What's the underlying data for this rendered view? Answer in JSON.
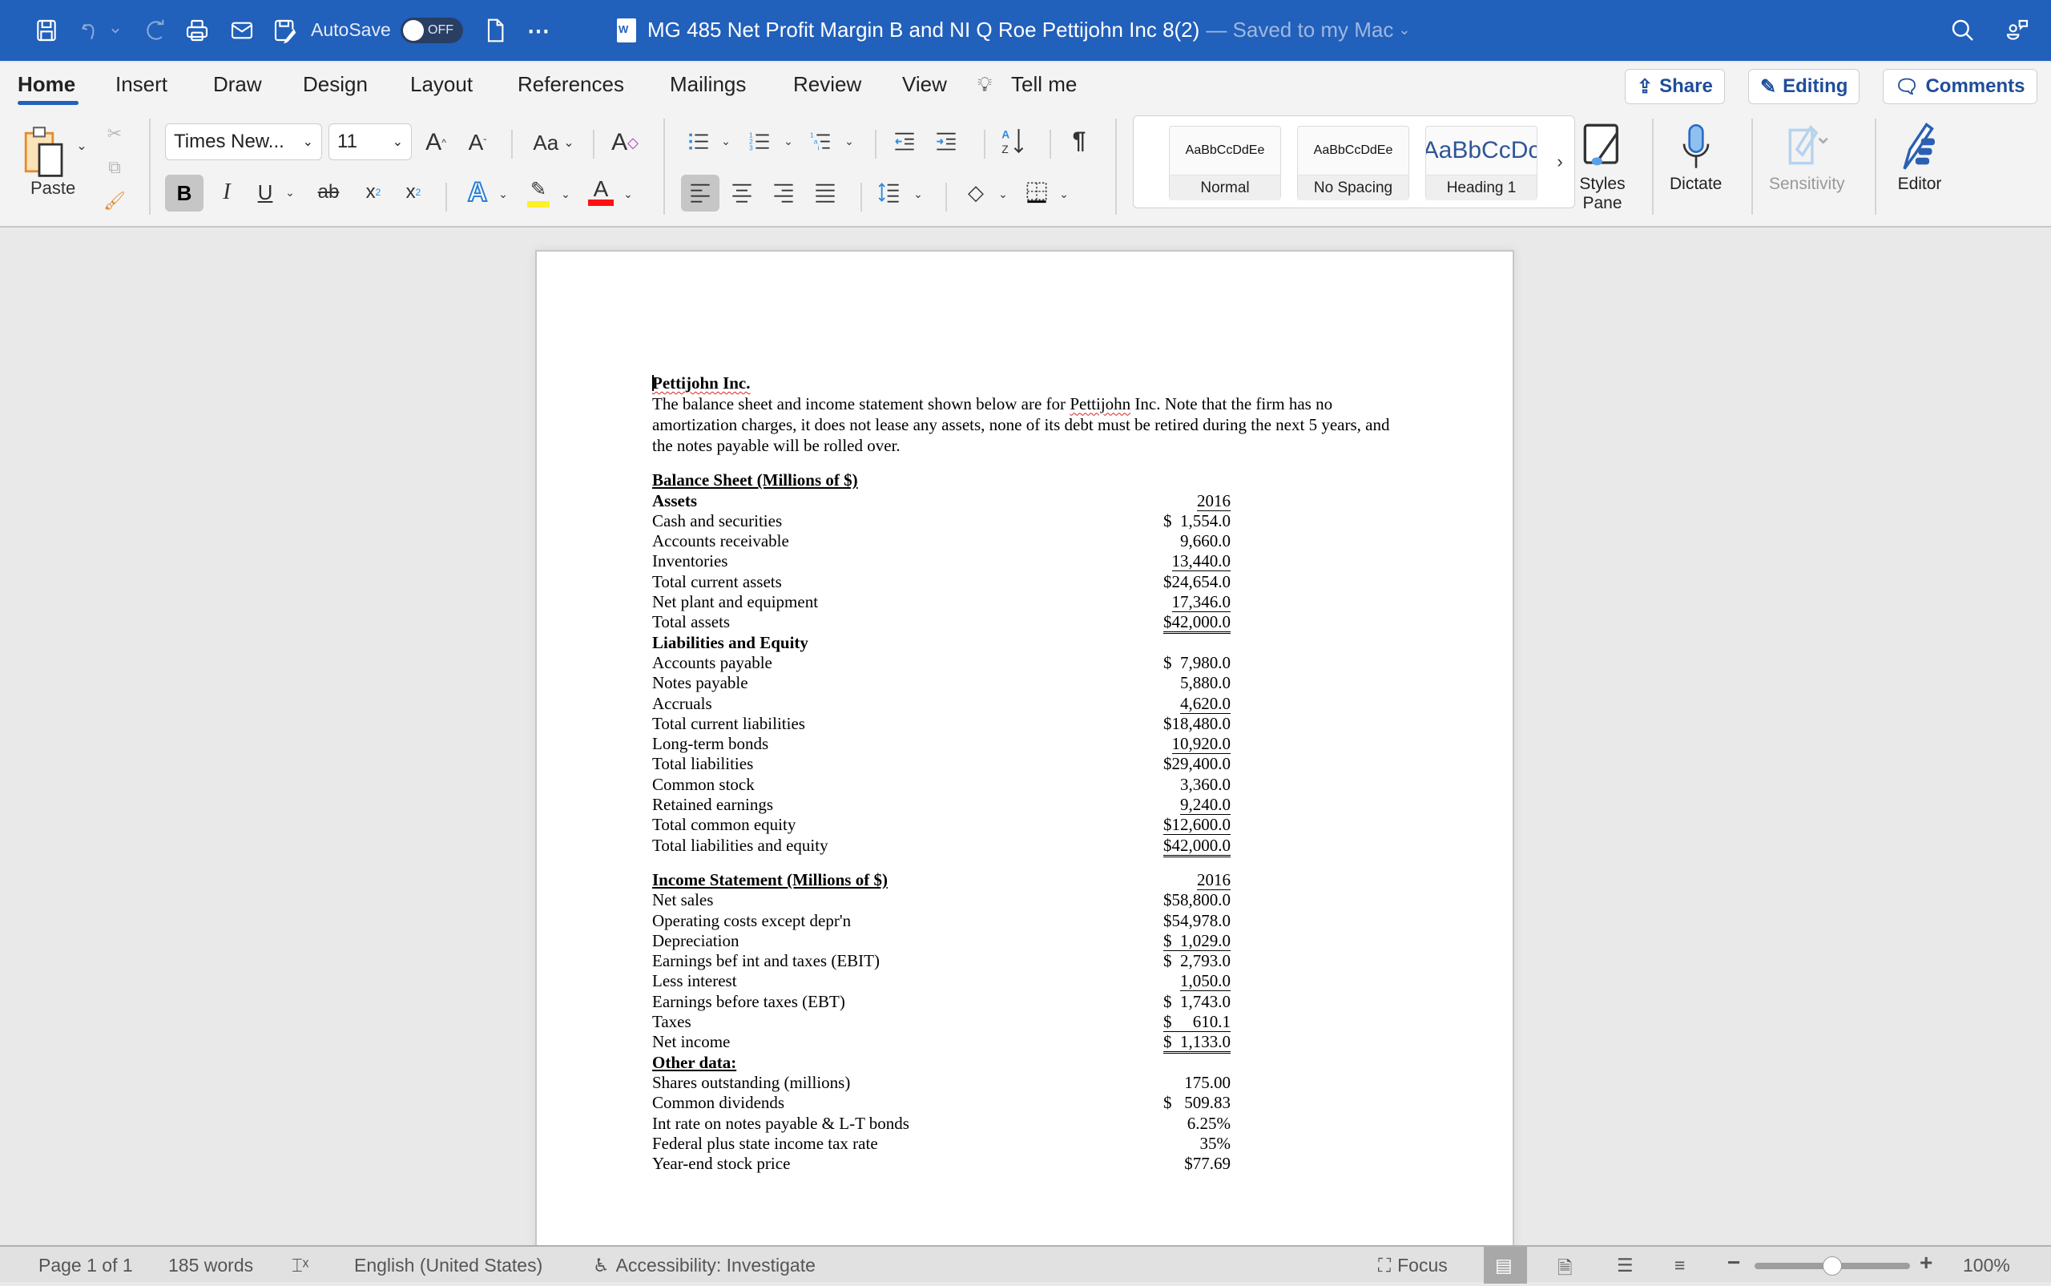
{
  "titlebar": {
    "autosave_label": "AutoSave",
    "autosave_state": "OFF",
    "document_title": "MG 485 Net Profit Margin B and NI Q Roe Pettijohn Inc 8(2)",
    "save_status": "— Saved to my Mac",
    "accent_color": "#2160bb"
  },
  "tabs": [
    {
      "label": "Home",
      "active": true
    },
    {
      "label": "Insert"
    },
    {
      "label": "Draw"
    },
    {
      "label": "Design"
    },
    {
      "label": "Layout"
    },
    {
      "label": "References"
    },
    {
      "label": "Mailings"
    },
    {
      "label": "Review"
    },
    {
      "label": "View"
    },
    {
      "label": "Tell me"
    }
  ],
  "header_buttons": {
    "share": "Share",
    "editing": "Editing",
    "comments": "Comments"
  },
  "ribbon": {
    "paste_label": "Paste",
    "font_name": "Times New...",
    "font_size": "11",
    "change_case": "Aa",
    "bold": "B",
    "italic": "I",
    "underline": "U",
    "strike": "ab",
    "styles": [
      {
        "preview": "AaBbCcDdEe",
        "name": "Normal"
      },
      {
        "preview": "AaBbCcDdEe",
        "name": "No Spacing"
      },
      {
        "preview": "AaBbCcDc",
        "name": "Heading 1"
      }
    ],
    "styles_pane": "Styles Pane",
    "dictate": "Dictate",
    "sensitivity": "Sensitivity",
    "editor": "Editor"
  },
  "document": {
    "company": "Pettijohn Inc.",
    "intro_before": "The balance sheet and income statement shown below are for ",
    "intro_company": "Pettijohn",
    "intro_after": " Inc. Note that the firm has no amortization charges, it does not lease any assets, none of its debt must be retired during the next 5 years, and the notes payable will be rolled over.",
    "balance_sheet": {
      "title": "Balance Sheet (Millions of $)",
      "year": "2016",
      "assets_heading": "Assets",
      "assets": [
        {
          "label": "Cash and securities",
          "value": "$  1,554.0"
        },
        {
          "label": "Accounts receivable",
          "value": "9,660.0"
        },
        {
          "label": "Inventories",
          "value": "13,440.0",
          "underline": true
        },
        {
          "label": "Total current assets",
          "value": "$24,654.0"
        },
        {
          "label": "Net plant and equipment",
          "value": "17,346.0",
          "underline": true
        },
        {
          "label": "Total assets",
          "value": "$42,000.0",
          "double": true
        }
      ],
      "liabilities_heading": "Liabilities and Equity",
      "liabilities": [
        {
          "label": "Accounts payable",
          "value": "$  7,980.0"
        },
        {
          "label": "Notes payable",
          "value": "5,880.0"
        },
        {
          "label": "Accruals",
          "value": "4,620.0",
          "underline": true
        },
        {
          "label": "Total current liabilities",
          "value": "$18,480.0"
        },
        {
          "label": "Long-term bonds",
          "value": "10,920.0",
          "underline": true
        },
        {
          "label": "Total liabilities",
          "value": "$29,400.0"
        },
        {
          "label": "Common stock",
          "value": "3,360.0"
        },
        {
          "label": "Retained earnings",
          "value": "9,240.0",
          "underline": true
        },
        {
          "label": "Total common equity",
          "value": "$12,600.0",
          "underline": true
        },
        {
          "label": "Total liabilities and equity",
          "value": "$42,000.0",
          "double": true
        }
      ]
    },
    "income_statement": {
      "title": "Income Statement (Millions of $)",
      "year": "2016",
      "rows": [
        {
          "label": "Net sales",
          "value": "$58,800.0"
        },
        {
          "label": "Operating costs except depr'n",
          "value": "$54,978.0"
        },
        {
          "label": "Depreciation",
          "value": "$  1,029.0",
          "underline": true
        },
        {
          "label": "Earnings bef int and taxes (EBIT)",
          "value": "$  2,793.0"
        },
        {
          "label": "Less interest",
          "value": "1,050.0",
          "underline": true
        },
        {
          "label": "Earnings before taxes (EBT)",
          "value": "$  1,743.0"
        },
        {
          "label": "Taxes",
          "value": "$     610.1",
          "underline": true
        },
        {
          "label": "Net income",
          "value": "$  1,133.0",
          "double": true
        }
      ]
    },
    "other_data": {
      "title": "Other data:",
      "rows": [
        {
          "label": "Shares outstanding (millions)",
          "value": "175.00"
        },
        {
          "label": "Common dividends",
          "value": "$   509.83"
        },
        {
          "label": "Int rate on notes payable & L-T bonds",
          "value": "6.25%"
        },
        {
          "label": "Federal plus state income tax rate",
          "value": "35%"
        },
        {
          "label": "Year-end stock price",
          "value": "$77.69"
        }
      ]
    }
  },
  "statusbar": {
    "page": "Page 1 of 1",
    "words": "185 words",
    "language": "English (United States)",
    "accessibility": "Accessibility: Investigate",
    "focus": "Focus",
    "zoom_percent": "100%",
    "zoom_slider_fraction": 0.5
  }
}
